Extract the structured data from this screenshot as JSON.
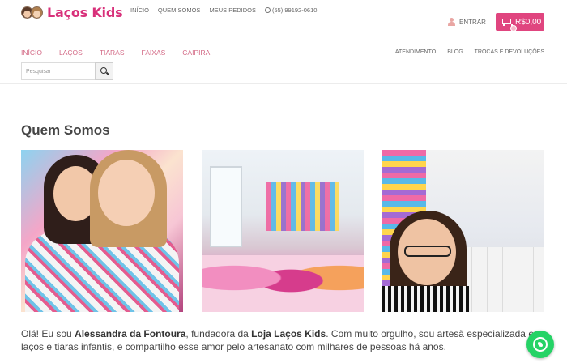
{
  "header": {
    "logo_text": "Laços Kids",
    "top_links": [
      "INÍCIO",
      "QUEM SOMOS",
      "MEUS PEDIDOS"
    ],
    "phone": "(55) 99192-0610",
    "login_label": "ENTRAR",
    "cart_total": "R$0,00"
  },
  "main_nav": [
    "INÍCIO",
    "LAÇOS",
    "TIARAS",
    "FAIXAS",
    "CAIPIRA"
  ],
  "secondary_nav": [
    "ATENDIMENTO",
    "BLOG",
    "TROCAS E DEVOLUÇÕES"
  ],
  "search": {
    "placeholder": "Pesquisar"
  },
  "page": {
    "title": "Quem Somos",
    "intro": {
      "part1": "Olá! Eu sou ",
      "name": "Alessandra da Fontoura",
      "part2": ", fundadora da ",
      "store": "Loja Laços Kids",
      "part3": ". Com muito orgulho, sou artesã especializada em laços e tiaras infantis, e compartilho esse amor pelo artesanato com milhares de pessoas há anos."
    }
  },
  "colors": {
    "brand_pink": "#e0457f",
    "nav_pink": "#d36a86",
    "whatsapp_green": "#25d366"
  },
  "icons": [
    "user-icon",
    "cart-icon",
    "search-icon",
    "phone-icon",
    "whatsapp-icon"
  ]
}
